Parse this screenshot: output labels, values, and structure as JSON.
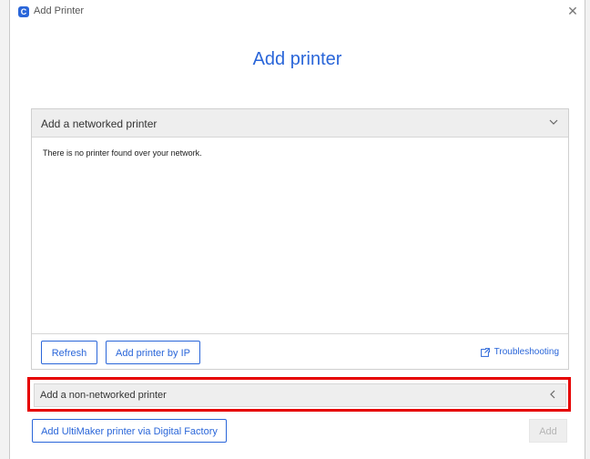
{
  "window": {
    "title": "Add Printer",
    "app_icon_letter": "C"
  },
  "heading": "Add printer",
  "networked": {
    "header_label": "Add a networked printer",
    "empty_message": "There is no printer found over your network.",
    "refresh_label": "Refresh",
    "add_by_ip_label": "Add printer by IP",
    "troubleshooting_label": "Troubleshooting"
  },
  "non_networked": {
    "header_label": "Add a non-networked printer"
  },
  "footer": {
    "digital_factory_label": "Add UltiMaker printer via Digital Factory",
    "add_label": "Add"
  },
  "colors": {
    "accent": "#2a66d9",
    "highlight": "#e60000"
  }
}
